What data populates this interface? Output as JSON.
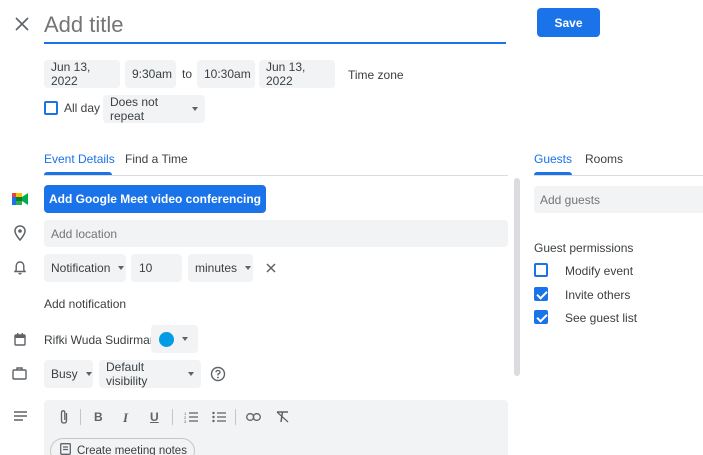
{
  "header": {
    "title_placeholder": "Add title",
    "save_label": "Save"
  },
  "datetime": {
    "start_date": "Jun 13, 2022",
    "start_time": "9:30am",
    "to_label": "to",
    "end_time": "10:30am",
    "end_date": "Jun 13, 2022",
    "timezone_label": "Time zone",
    "all_day_label": "All day",
    "all_day_checked": false,
    "repeat_label": "Does not repeat"
  },
  "tabs": {
    "event_details": "Event Details",
    "find_time": "Find a Time",
    "guests": "Guests",
    "rooms": "Rooms"
  },
  "details": {
    "meet_button_label": "Add Google Meet video conferencing",
    "location_placeholder": "Add location",
    "notification_type": "Notification",
    "notification_value": "10",
    "notification_unit": "minutes",
    "add_notification_label": "Add notification",
    "calendar_owner": "Rifki Wuda Sudirman",
    "calendar_color": "#039be5",
    "busy_label": "Busy",
    "visibility_label": "Default visibility",
    "create_notes_label": "Create meeting notes"
  },
  "guests": {
    "add_placeholder": "Add guests",
    "permissions_title": "Guest permissions",
    "permissions": [
      {
        "label": "Modify event",
        "checked": false
      },
      {
        "label": "Invite others",
        "checked": true
      },
      {
        "label": "See guest list",
        "checked": true
      }
    ]
  },
  "colors": {
    "accent": "#1a73e8",
    "chip_bg": "#f1f3f4",
    "text": "#3c4043"
  }
}
